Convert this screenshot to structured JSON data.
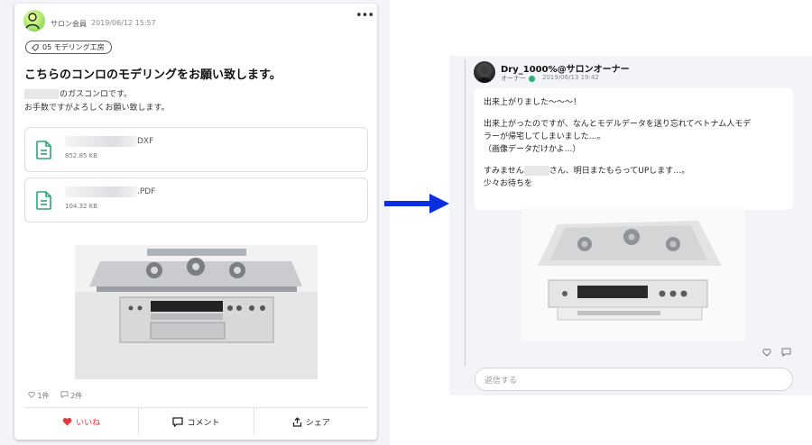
{
  "post": {
    "author_role": "サロン会員",
    "time": "2019/06/12 15:57",
    "more_icon": "more-horizontal-icon",
    "tag": "05 モデリング工房",
    "title": "こちらのコンロのモデリングをお願い致します。",
    "body_line1_suffix": "のガスコンロです。",
    "body_line2": "お手数ですがよろしくお願い致します。",
    "files": [
      {
        "ext": "DXF",
        "size": "852.85 KB",
        "icon": "document-icon"
      },
      {
        "ext": ".PDF",
        "size": "104.32 KB",
        "icon": "document-icon"
      }
    ],
    "likes_count": "1件",
    "comments_count": "2件",
    "actions": {
      "like": "いいね",
      "comment": "コメント",
      "share": "シェア"
    },
    "like_color": "#e53a3a"
  },
  "reply": {
    "author_name": "Dry_1000%@サロンオーナー",
    "author_role": "オーナー",
    "time": "2019/06/13 19:42",
    "lines": [
      "出来上がりました〜〜〜！",
      "出来上がったのですが、なんとモデルデータを送り忘れてベトナム人モデ",
      "ラーが帰宅してしまいました…。",
      "（画像データだけかよ…）",
      "すみません",
      "さん、明日またもらってUPします…。",
      "少々お待ちを"
    ],
    "input_placeholder": "返信する",
    "accent_color": "#2ab06f"
  },
  "arrow_color": "#0a2fe0"
}
